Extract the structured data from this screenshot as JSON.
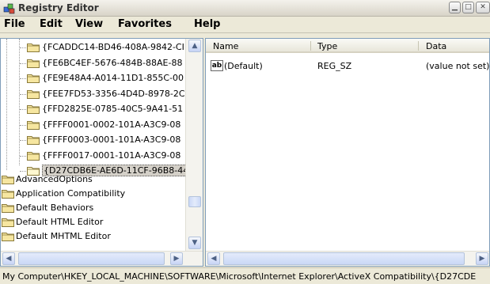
{
  "window": {
    "title": "Registry Editor",
    "icon": "registry-editor-icon"
  },
  "menu": [
    "File",
    "Edit",
    "View",
    "Favorites",
    "Help"
  ],
  "tree": {
    "nested_items": [
      "{FCADDC14-BD46-408A-9842-CI",
      "{FE6BC4EF-5676-484B-88AE-88",
      "{FE9E48A4-A014-11D1-855C-00",
      "{FEE7FD53-3356-4D4D-8978-2C",
      "{FFD2825E-0785-40C5-9A41-51",
      "{FFFF0001-0002-101A-A3C9-08",
      "{FFFF0003-0001-101A-A3C9-08",
      "{FFFF0017-0001-101A-A3C9-08",
      "{D27CDB6E-AE6D-11CF-96B8-44"
    ],
    "selected_index": 8,
    "top_items": [
      "AdvancedOptions",
      "Application Compatibility",
      "Default Behaviors",
      "Default HTML Editor",
      "Default MHTML Editor"
    ]
  },
  "list": {
    "columns": [
      "Name",
      "Type",
      "Data"
    ],
    "rows": [
      {
        "name": "(Default)",
        "type": "REG_SZ",
        "data": "(value not set)",
        "icon": "string-value-icon"
      }
    ]
  },
  "status": "My Computer\\HKEY_LOCAL_MACHINE\\SOFTWARE\\Microsoft\\Internet Explorer\\ActiveX Compatibility\\{D27CDE"
}
